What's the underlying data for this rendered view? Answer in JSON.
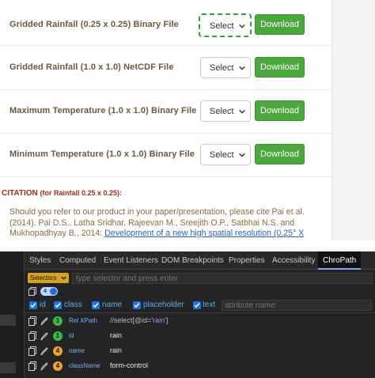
{
  "files": [
    {
      "label": "Gridded Rainfall (0.25 x 0.25) Binary File",
      "select": "Select",
      "button": "Download",
      "focused": true
    },
    {
      "label": "Gridded Rainfall (1.0 x 1.0) NetCDF File",
      "select": "Select",
      "button": "Download",
      "focused": false
    },
    {
      "label": "Maximum Temperature (1.0 x 1.0) Binary File",
      "select": "Select",
      "button": "Download",
      "focused": false
    },
    {
      "label": "Minimum Temperature (1.0 x 1.0) Binary File",
      "select": "Select",
      "button": "Download",
      "focused": false
    }
  ],
  "citation": {
    "title": "CITATION",
    "note": "(for Rainfall 0.25 x 0.25):",
    "lines": [
      "Should you refer to our product in your paper/presentation, please cite Pai et al.",
      "(2014). Pai D.S., Latha Sridhar, Rajeevan M., Sreejith O.P., Satbhai N.S. and"
    ],
    "line3_plain": "Mukhopadhyay B., 2014: ",
    "line3_link": "Development of a new high spatial resolution (0.25° X"
  },
  "devtools": {
    "tabs": [
      "Styles",
      "Computed",
      "Event Listeners",
      "DOM Breakpoints",
      "Properties",
      "Accessibility",
      "ChroPath"
    ],
    "active_tab": "ChroPath",
    "selector_dropdown": "Selectors",
    "selector_placeholder": "type selector and press enter",
    "match_count": "4",
    "attributes": [
      "id",
      "class",
      "name",
      "placeholder",
      "text"
    ],
    "attribute_placeholder": "attribute name",
    "results": [
      {
        "badge": "1",
        "badge_color": "#2fbf3f",
        "name": "Rel XPath",
        "value_prefix": "//",
        "value_tag": "select",
        "value_pred_open": "[@id='",
        "value_quoted": "rain",
        "value_pred_close": "']"
      },
      {
        "badge": "1",
        "badge_color": "#2fbf3f",
        "name": "id",
        "value": "rain"
      },
      {
        "badge": "4",
        "badge_color": "#f2a32b",
        "name": "name",
        "value": "rain"
      },
      {
        "badge": "4",
        "badge_color": "#f2a32b",
        "name": "className",
        "value": "form-control"
      }
    ]
  },
  "colors": {
    "download_green": "#4aa83c",
    "focus_outline": "#27a34a",
    "label_brown": "#6b5a3c",
    "citation_red": "#a0301a",
    "chropath_blue": "#1a73e8"
  },
  "icons": [
    "chevron-down-icon",
    "copy-icon",
    "edit-pencil-icon",
    "checkbox-checked-icon"
  ]
}
